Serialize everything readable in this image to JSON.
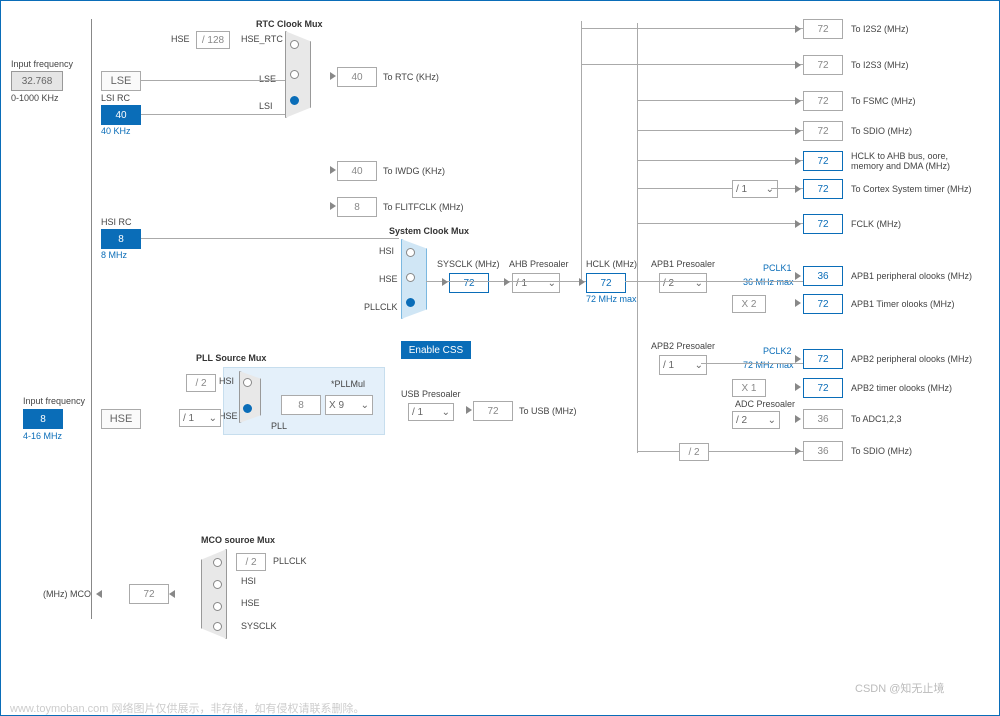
{
  "inputs": {
    "freq1_label": "Input frequency",
    "freq1_value": "32.768",
    "freq1_range": "0-1000 KHz",
    "freq2_label": "Input frequency",
    "freq2_value": "8",
    "freq2_range": "4-16 MHz"
  },
  "sources": {
    "lse": "LSE",
    "lsi_rc": "LSI RC",
    "lsi_value": "40",
    "lsi_unit": "40 KHz",
    "hsi_rc": "HSI RC",
    "hsi_value": "8",
    "hsi_unit": "8 MHz",
    "hse": "HSE"
  },
  "rtc": {
    "title": "RTC Clook Mux",
    "hse_label": "HSE",
    "div128": "/ 128",
    "hse_rtc": "HSE_RTC",
    "lse_label": "LSE",
    "lsi_label": "LSI",
    "out_value": "40",
    "out_label": "To RTC (KHz)"
  },
  "iwdg": {
    "value": "40",
    "label": "To IWDG (KHz)"
  },
  "flitf": {
    "value": "8",
    "label": "To FLITFCLK (MHz)"
  },
  "sysmux": {
    "title": "System Clook Mux",
    "hsi": "HSI",
    "hse": "HSE",
    "pllclk": "PLLCLK",
    "enable_css": "Enable CSS"
  },
  "sysclk": {
    "label": "SYSCLK (MHz)",
    "value": "72"
  },
  "ahb": {
    "label": "AHB Presoaler",
    "value": "/ 1"
  },
  "hclk": {
    "label": "HCLK (MHz)",
    "value": "72",
    "sub": "72 MHz max"
  },
  "pll": {
    "title": "PLL Source Mux",
    "div2": "/ 2",
    "hsi": "HSI",
    "hse": "HSE",
    "div1": "/ 1",
    "pll_label": "PLL",
    "pllmul_label": "*PLLMul",
    "in_value": "8",
    "mul": "X 9"
  },
  "usb": {
    "label": "USB Presoaler",
    "div": "/ 1",
    "value": "72",
    "to": "To USB (MHz)"
  },
  "outputs": {
    "i2s2": {
      "value": "72",
      "label": "To I2S2 (MHz)"
    },
    "i2s3": {
      "value": "72",
      "label": "To I2S3 (MHz)"
    },
    "fsmc": {
      "value": "72",
      "label": "To FSMC (MHz)"
    },
    "sdio": {
      "value": "72",
      "label": "To SDIO (MHz)"
    },
    "hclk_ahb": {
      "value": "72",
      "label": "HCLK to AHB bus, oore, memory and DMA (MHz)"
    },
    "cortex_div": "/ 1",
    "cortex": {
      "value": "72",
      "label": "To Cortex System timer (MHz)"
    },
    "fclk": {
      "value": "72",
      "label": "FCLK (MHz)"
    }
  },
  "apb1": {
    "title": "APB1 Presoaler",
    "div": "/ 2",
    "pclk1_label": "PCLK1",
    "pclk1_sub": "36 MHz max",
    "periph": {
      "value": "36",
      "label": "APB1 peripheral olooks (MHz)"
    },
    "x2": "X 2",
    "timer": {
      "value": "72",
      "label": "APB1 Timer olooks (MHz)"
    }
  },
  "apb2": {
    "title": "APB2 Presoaler",
    "div": "/ 1",
    "pclk2_label": "PCLK2",
    "pclk2_sub": "72 MHz max",
    "periph": {
      "value": "72",
      "label": "APB2 peripheral olooks (MHz)"
    },
    "x1": "X 1",
    "timer": {
      "value": "72",
      "label": "APB2 timer olooks (MHz)"
    },
    "adc_label": "ADC Presoaler",
    "adc_div": "/ 2",
    "adc": {
      "value": "36",
      "label": "To ADC1,2,3"
    },
    "sdio_div": "/ 2",
    "sdio": {
      "value": "36",
      "label": "To SDIO (MHz)"
    }
  },
  "mco": {
    "title": "MCO souroe Mux",
    "div2": "/ 2",
    "pllclk": "PLLCLK",
    "hsi": "HSI",
    "hse": "HSE",
    "sysclk": "SYSCLK",
    "value": "72",
    "label": "(MHz) MCO"
  },
  "watermark": "www.toymoban.com 网络图片仅供展示，非存储，如有侵权请联系删除。",
  "credit": "CSDN @知无止境"
}
